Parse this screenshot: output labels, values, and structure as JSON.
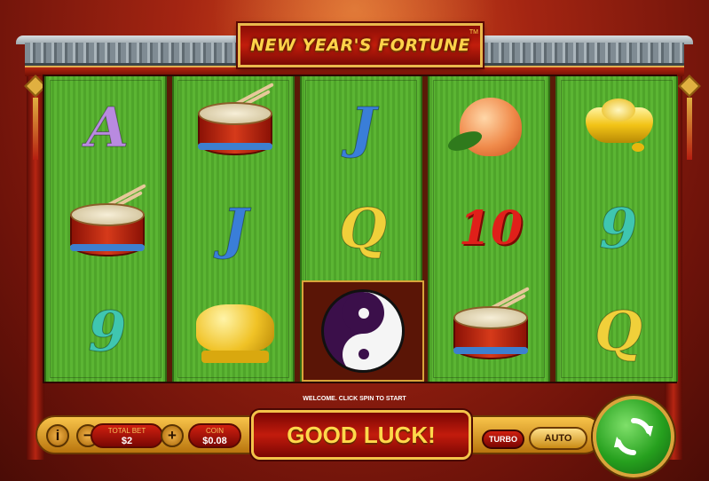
{
  "game": {
    "title": "NEW YEAR'S FORTUNE",
    "trademark": "TM"
  },
  "reels": [
    [
      {
        "symbol": "A",
        "color": "#b98ae0"
      },
      {
        "symbol": "drum"
      },
      {
        "symbol": "9",
        "color": "#3fc6b0"
      }
    ],
    [
      {
        "symbol": "drum"
      },
      {
        "symbol": "J",
        "color": "#3a7ed8"
      },
      {
        "symbol": "golden-pig"
      }
    ],
    [
      {
        "symbol": "J",
        "color": "#3a7ed8"
      },
      {
        "symbol": "Q",
        "color": "#f0d03a"
      },
      {
        "symbol": "yin-yang"
      }
    ],
    [
      {
        "symbol": "peach"
      },
      {
        "symbol": "10",
        "color": "#e0201a"
      },
      {
        "symbol": "drum"
      }
    ],
    [
      {
        "symbol": "gold-ingot"
      },
      {
        "symbol": "9",
        "color": "#3fc6b0"
      },
      {
        "symbol": "Q",
        "color": "#f0d03a"
      }
    ]
  ],
  "message": "WELCOME. CLICK SPIN TO START",
  "controls": {
    "info": "i",
    "minus": "−",
    "plus": "+",
    "total_bet_label": "TOTAL BET",
    "total_bet_value": "$2",
    "coin_label": "COIN",
    "coin_value": "$0.08",
    "status": "GOOD LUCK!",
    "turbo_label": "TURBO",
    "auto_label": "AUTO",
    "spin_icon": "refresh-arrows-icon"
  }
}
